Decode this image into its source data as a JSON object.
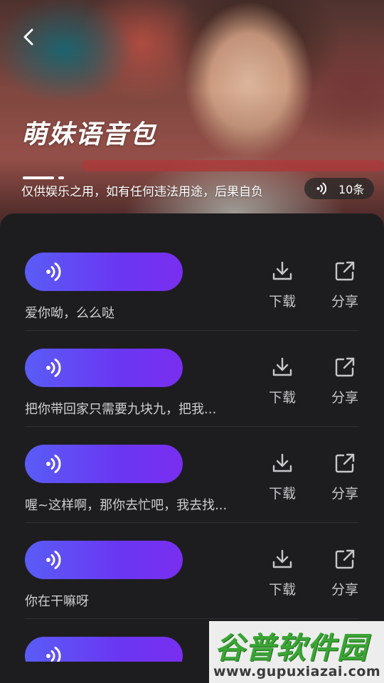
{
  "header": {
    "title": "萌妹语音包",
    "subtitle": "仅供娱乐之用，如有任何违法用途，后果自负",
    "count": "10条"
  },
  "actions": {
    "download_label": "下载",
    "share_label": "分享"
  },
  "items": [
    {
      "text": "爱你呦，么么哒"
    },
    {
      "text": "把你带回家只需要九块九，把我..."
    },
    {
      "text": "喔~这样啊，那你去忙吧，我去找..."
    },
    {
      "text": "你在干嘛呀"
    },
    {
      "text": ""
    }
  ],
  "watermark": {
    "brand": "谷普软件园",
    "url": "www.gupuxiazai.com"
  },
  "colors": {
    "sheet_bg": "#1d1d1f",
    "pill_start": "#5a5cf6",
    "pill_end": "#7a2ef0"
  },
  "icons": {
    "back": "chevron-left-icon",
    "sound": "sound-wave-icon",
    "download": "download-icon",
    "share": "external-share-icon"
  }
}
